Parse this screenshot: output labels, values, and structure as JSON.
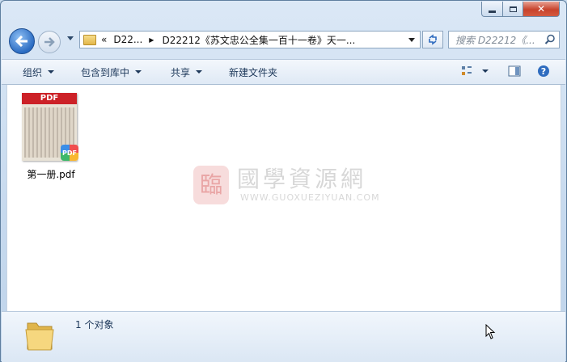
{
  "window": {
    "buttons": {
      "minimize": "minimize",
      "maximize": "maximize",
      "close": "close"
    }
  },
  "address": {
    "prefix": "«",
    "segments": [
      "D22...",
      "D22212《苏文忠公全集一百十一卷》天一..."
    ]
  },
  "search": {
    "placeholder": "搜索 D22212《..."
  },
  "toolbar": {
    "organize": "组织",
    "include_in_library": "包含到库中",
    "share": "共享",
    "new_folder": "新建文件夹"
  },
  "files": [
    {
      "name": "第一册.pdf",
      "thumb_label": "PDF",
      "badge": "PDF"
    }
  ],
  "watermark": {
    "seal": "臨",
    "title": "國學資源網",
    "url": "WWW.GUOXUEZIYUAN.COM"
  },
  "details": {
    "count_text": "1 个对象"
  },
  "colors": {
    "accent": "#2b6cc2",
    "close": "#c7432c",
    "pdf_red": "#cc2127"
  }
}
